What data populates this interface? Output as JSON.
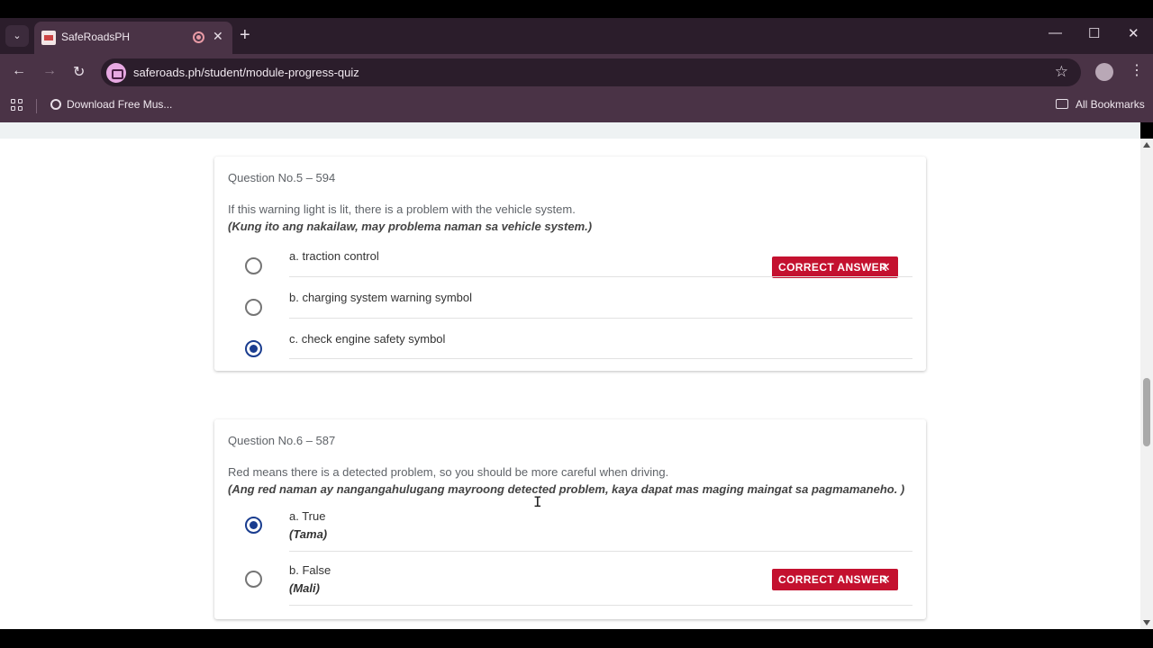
{
  "browser": {
    "tab_title": "SafeRoadsPH",
    "tab_close": "✕",
    "new_tab": "+",
    "url": "saferoads.ph/student/module-progress-quiz",
    "bookmark_1": "Download Free Mus...",
    "all_bookmarks": "All Bookmarks",
    "minimize": "—",
    "maximize": "☐",
    "close": "✕",
    "back": "←",
    "forward": "→",
    "reload": "↻",
    "star": "☆",
    "menu": "⋮",
    "tab_menu": "⌄"
  },
  "questions": [
    {
      "number": "Question No.5 – 594",
      "text": "If this warning light is lit, there is a problem with the vehicle system.",
      "text_tl": "(Kung ito ang nakailaw, may problema naman sa vehicle system.)",
      "options": [
        {
          "label": "a. traction control",
          "selected": false,
          "correct": true
        },
        {
          "label": "b. charging system warning symbol",
          "selected": false,
          "correct": false
        },
        {
          "label": "c. check engine safety symbol",
          "selected": true,
          "correct": false
        }
      ]
    },
    {
      "number": "Question No.6 – 587",
      "text": "Red means there is a detected problem, so you should be more careful when driving.",
      "text_tl": "(Ang red naman ay nangangahulugang mayroong detected problem, kaya dapat mas maging maingat sa pagmamaneho. )",
      "options": [
        {
          "label": "a. True",
          "sub": "(Tama)",
          "selected": true,
          "correct": false
        },
        {
          "label": "b. False",
          "sub": "(Mali)",
          "selected": false,
          "correct": true
        }
      ]
    }
  ],
  "badge": {
    "label": "CORRECT ANSWER",
    "close": "✕"
  },
  "colors": {
    "accent": "#1a3d8f",
    "badge": "#c4112f",
    "browser_frame": "#4a3346"
  }
}
